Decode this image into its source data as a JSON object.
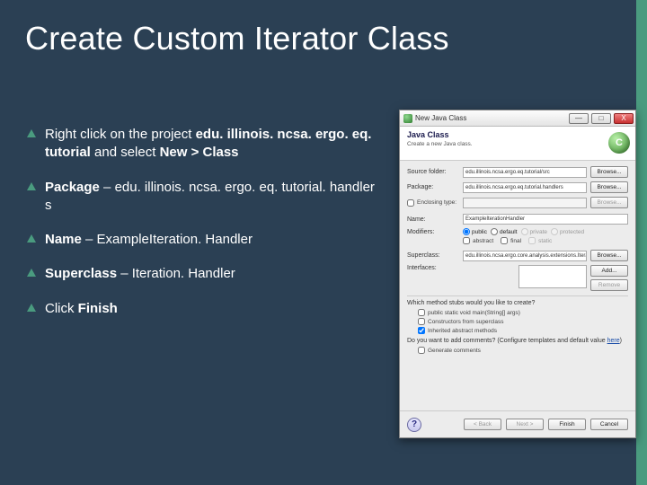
{
  "slide": {
    "title": "Create Custom Iterator Class",
    "bullets": [
      {
        "pre": "Right click on the project ",
        "bold1": "edu. illinois. ncsa. ergo. eq. tutorial",
        "mid": " and select ",
        "bold2": "New > Class",
        "post": ""
      },
      {
        "bold1": "Package",
        "mid": " – edu. illinois. ncsa. ergo. eq. tutorial. handler s"
      },
      {
        "bold1": "Name",
        "mid": " – ExampleIteration. Handler"
      },
      {
        "bold1": "Superclass",
        "mid": " – Iteration. Handler"
      },
      {
        "pre": "Click ",
        "bold1": "Finish"
      }
    ]
  },
  "dialog": {
    "window_title": "New Java Class",
    "banner_heading": "Java Class",
    "banner_sub": "Create a new Java class.",
    "badge_glyph": "C",
    "labels": {
      "source_folder": "Source folder:",
      "package": "Package:",
      "enclosing": "Enclosing type:",
      "name": "Name:",
      "modifiers": "Modifiers:",
      "superclass": "Superclass:",
      "interfaces": "Interfaces:"
    },
    "values": {
      "source_folder": "edu.illinois.ncsa.ergo.eq.tutorial/src",
      "package": "edu.illinois.ncsa.ergo.eq.tutorial.handlers",
      "name": "ExampleIterationHandler",
      "superclass": "edu.illinois.ncsa.ergo.core.analysis.extensions.IterationHandl"
    },
    "buttons": {
      "browse": "Browse...",
      "add": "Add...",
      "remove": "Remove",
      "back": "< Back",
      "next": "Next >",
      "finish": "Finish",
      "cancel": "Cancel"
    },
    "modifiers": {
      "public": "public",
      "default": "default",
      "private": "private",
      "protected": "protected",
      "abstract": "abstract",
      "final": "final",
      "static": "static"
    },
    "stubs": {
      "question": "Which method stubs would you like to create?",
      "main": "public static void main(String[] args)",
      "super_ctor": "Constructors from superclass",
      "inherited": "Inherited abstract methods",
      "comments_q": "Do you want to add comments? (Configure templates and default value ",
      "here": "here",
      "comments_end": ")",
      "generate": "Generate comments"
    },
    "win": {
      "min": "—",
      "max": "□",
      "close": "X"
    },
    "help_glyph": "?"
  }
}
